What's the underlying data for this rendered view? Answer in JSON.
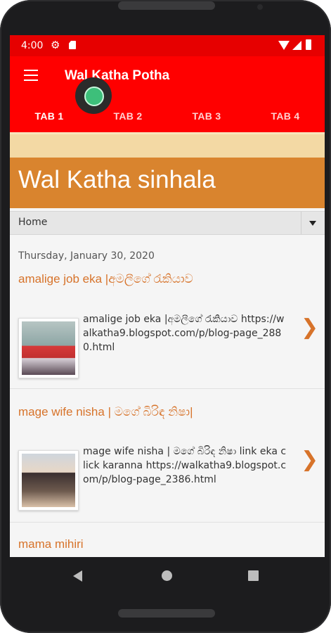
{
  "status": {
    "time": "4:00",
    "icons": [
      "gear-icon",
      "sd-card-icon",
      "wifi-icon",
      "signal-icon",
      "battery-icon"
    ]
  },
  "appbar": {
    "title": "Wal Katha Potha",
    "menu_icon": "hamburger-menu-icon"
  },
  "tabs": [
    {
      "label": "TAB 1",
      "active": true
    },
    {
      "label": "TAB 2",
      "active": false
    },
    {
      "label": "TAB 3",
      "active": false
    },
    {
      "label": "TAB 4",
      "active": false
    }
  ],
  "blog": {
    "title": "Wal Katha sinhala"
  },
  "nav": {
    "home": "Home",
    "dropdown_icon": "dropdown-arrow-icon"
  },
  "date": "Thursday, January 30, 2020",
  "posts": [
    {
      "title": "amalige job eka |අමලීගේ රැකියාව",
      "snippet": "amalige job eka |අමලීගේ රැකියාව https://walkatha9.blogspot.com/p/blog-page_2880.html"
    },
    {
      "title": "mage wife nisha | මගේ බිරිඳ නිෂා|",
      "snippet": "mage wife nisha | මගේ බිරිඳ නිෂා link eka click karanna https://walkatha9.blogspot.com/p/blog-page_2386.html"
    },
    {
      "title": "mama mihiri"
    }
  ],
  "colors": {
    "appbar": "#ff0000",
    "statusbar": "#e60000",
    "header": "#d9842e",
    "accent": "#d7732a",
    "cream": "#f3d9a4"
  }
}
